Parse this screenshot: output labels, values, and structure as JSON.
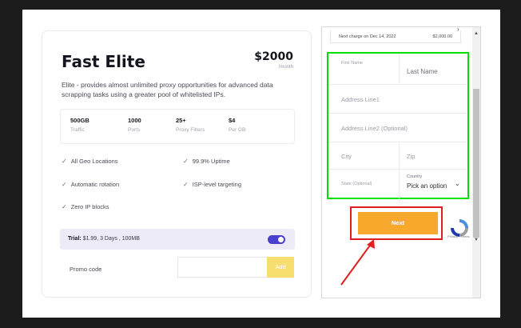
{
  "plan": {
    "title": "Fast Elite",
    "price": "$2000",
    "period": "/month",
    "description": "Elite - provides almost unlimited proxy opportunities for advanced data scrapping tasks using a greater pool of whitelisted IPs.",
    "stats": [
      {
        "value": "500GB",
        "label": "Traffic"
      },
      {
        "value": "1000",
        "label": "Ports"
      },
      {
        "value": "25+",
        "label": "Proxy Filters"
      },
      {
        "value": "$4",
        "label": "Per GB"
      }
    ],
    "features": [
      "All Geo Locations",
      "99.9% Uptime",
      "Automatic rotation",
      "ISP-level targeting",
      "Zero IP blocks"
    ],
    "trial_label": "Trial:",
    "trial_value": "$1.99, 3 Days , 100MB",
    "trial_enabled": true,
    "promo_label": "Promo code",
    "promo_placeholder": "",
    "promo_button": "Add"
  },
  "billing": {
    "next_charge_label": "Next charge on Dec 14, 2022",
    "next_charge_amount": "$2,000.00",
    "fields": {
      "first_name": "First Name",
      "last_name": "Last Name",
      "address1": "Address Line1",
      "address2": "Address Line2 (Optional)",
      "city": "City",
      "zip": "Zip",
      "state": "State (Optional)",
      "country_label": "Country",
      "country_value": "Pick an option"
    },
    "next_button": "Next",
    "recaptcha_text": "Privacy - Terms"
  },
  "colors": {
    "accent": "#4b3fcf",
    "next_button": "#f7a82d",
    "add_button": "#f8de6e",
    "form_highlight": "#00e000",
    "button_highlight": "#e02020",
    "arrow": "#e02020"
  }
}
